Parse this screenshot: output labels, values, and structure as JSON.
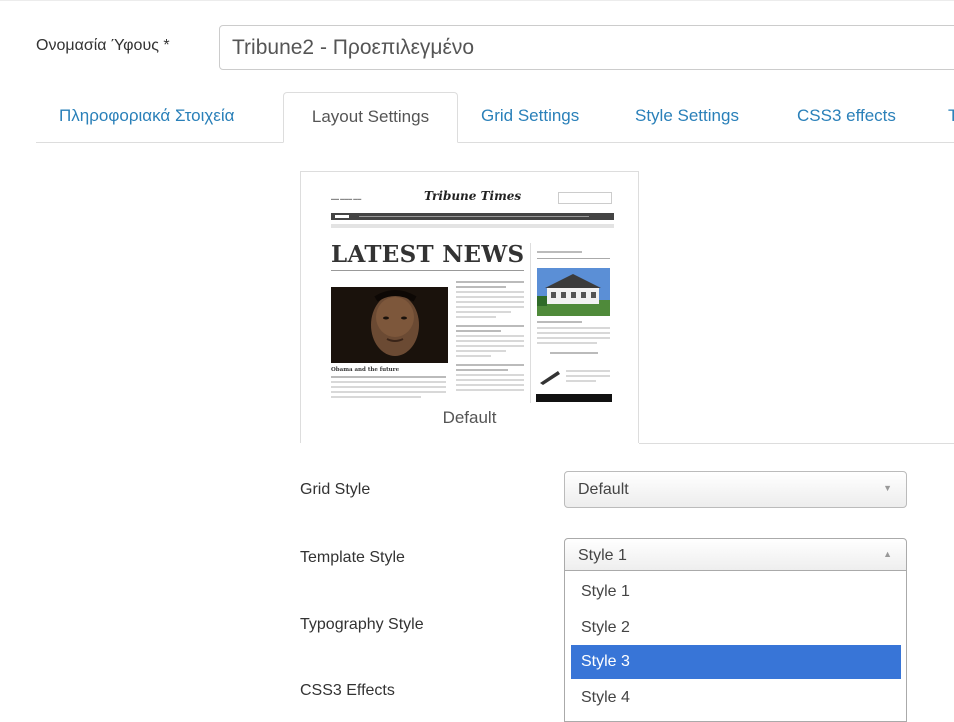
{
  "style_name": {
    "label": "Ονομασία Ύφους *",
    "value": "Tribune2 - Προεπιλεγμένο"
  },
  "tabs": [
    {
      "label": "Πληροφοριακά Στοιχεία",
      "active": false
    },
    {
      "label": "Layout Settings",
      "active": true
    },
    {
      "label": "Grid Settings",
      "active": false
    },
    {
      "label": "Style Settings",
      "active": false
    },
    {
      "label": "CSS3 effects",
      "active": false
    },
    {
      "label": "T",
      "active": false
    }
  ],
  "preview": {
    "caption": "Default",
    "thumbnail": {
      "masthead": "Tribune Times",
      "headline": "LATEST NEWS",
      "photo_caption": "Obama and the future"
    }
  },
  "form": {
    "grid_style": {
      "label": "Grid Style",
      "value": "Default"
    },
    "template_style": {
      "label": "Template Style",
      "value": "Style 1",
      "options": [
        "Style 1",
        "Style 2",
        "Style 3",
        "Style 4"
      ],
      "highlighted_option": "Style 3"
    },
    "typography_style": {
      "label": "Typography Style"
    },
    "css3_effects": {
      "label": "CSS3 Effects"
    }
  },
  "colors": {
    "link": "#2a80b9",
    "highlight": "#3875d7",
    "border": "#dddddd"
  },
  "icons": {
    "select_arrow_down": "▼",
    "select_arrow_up": "▲"
  }
}
